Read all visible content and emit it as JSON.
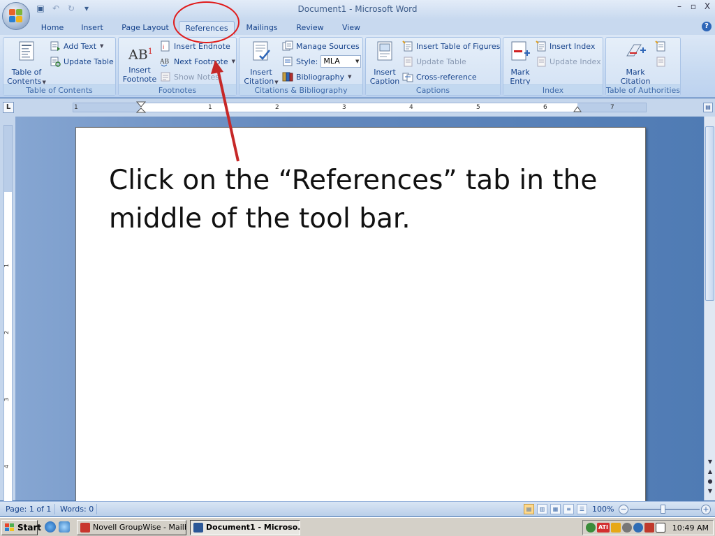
{
  "window": {
    "title": "Document1 - Microsoft Word",
    "minimize": "–",
    "maximize": "▫",
    "close": "X"
  },
  "tabs": [
    {
      "label": "Home"
    },
    {
      "label": "Insert"
    },
    {
      "label": "Page Layout"
    },
    {
      "label": "References",
      "active": true
    },
    {
      "label": "Mailings"
    },
    {
      "label": "Review"
    },
    {
      "label": "View"
    }
  ],
  "ribbon": {
    "toc": {
      "label": "Table of Contents",
      "btn_line1": "Table of",
      "btn_line2": "Contents",
      "add_text": "Add Text",
      "update_table": "Update Table"
    },
    "footnotes": {
      "label": "Footnotes",
      "insert_line1": "Insert",
      "insert_line2": "Footnote",
      "insert_endnote": "Insert Endnote",
      "next_footnote": "Next Footnote",
      "show_notes": "Show Notes",
      "ab_glyph": "AB"
    },
    "citations": {
      "label": "Citations & Bibliography",
      "insert_line1": "Insert",
      "insert_line2": "Citation",
      "manage_sources": "Manage Sources",
      "style_label": "Style:",
      "style_value": "MLA",
      "bibliography": "Bibliography"
    },
    "captions": {
      "label": "Captions",
      "insert_line1": "Insert",
      "insert_line2": "Caption",
      "insert_table_figures": "Insert Table of Figures",
      "update_table": "Update Table",
      "cross_reference": "Cross-reference"
    },
    "index": {
      "label": "Index",
      "mark_line1": "Mark",
      "mark_line2": "Entry",
      "insert_index": "Insert Index",
      "update_index": "Update Index"
    },
    "authorities": {
      "label": "Table of Authorities",
      "mark_line1": "Mark",
      "mark_line2": "Citation"
    }
  },
  "ruler": {
    "corner": "L",
    "h_numbers": [
      "1",
      "1",
      "2",
      "3",
      "4",
      "5",
      "6",
      "7"
    ],
    "v_numbers": [
      "1",
      "2",
      "3",
      "4"
    ]
  },
  "document": {
    "body_text": "Click on the “References” tab in the middle of the tool bar."
  },
  "statusbar": {
    "page": "Page: 1 of 1",
    "words": "Words: 0",
    "zoom": "100%",
    "zoom_minus": "−",
    "zoom_plus": "+"
  },
  "taskbar": {
    "start": "Start",
    "tasks": [
      {
        "label": "Novell GroupWise - Mailbox"
      },
      {
        "label": "Document1 - Microso...",
        "active": true
      }
    ],
    "clock": "10:49 AM",
    "tray_ati": "ATI"
  },
  "colors": {
    "annotation_red": "#e01b1b",
    "ribbon_text": "#15428b",
    "workspace_blue": "#4f7bb4"
  }
}
